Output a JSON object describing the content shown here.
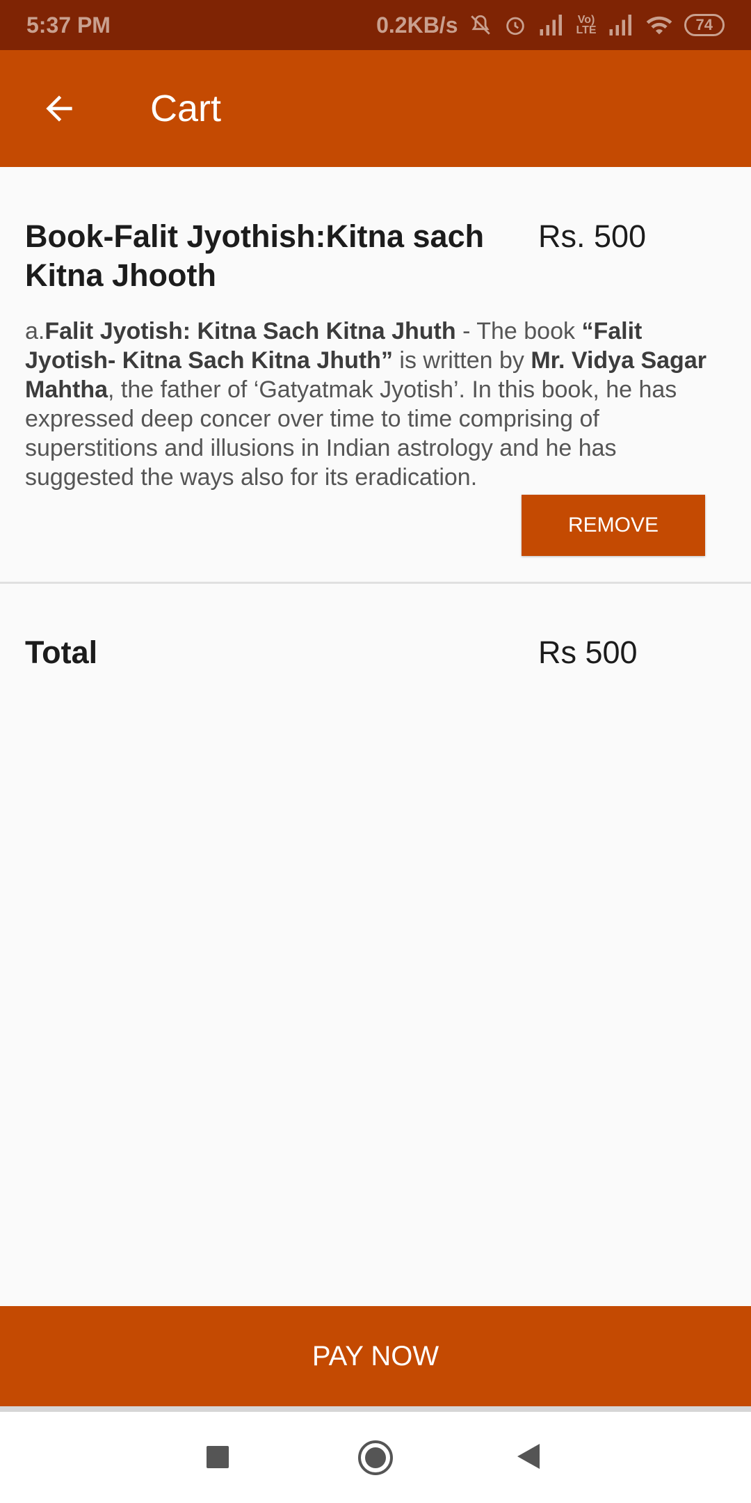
{
  "status_bar": {
    "time": "5:37 PM",
    "speed": "0.2KB/s",
    "battery": "74",
    "icons": [
      "mute-icon",
      "alarm-icon",
      "signal-icon",
      "volte-icon",
      "signal-icon",
      "wifi-icon",
      "battery-icon"
    ]
  },
  "app_bar": {
    "back_icon": "arrow-left-icon",
    "title": "Cart"
  },
  "cart_item": {
    "title": "Book-Falit Jyothish:Kitna sach Kitna Jhooth",
    "price": "Rs. 500",
    "description": {
      "prefix": "a.",
      "book_name": "Falit Jyotish: Kitna Sach Kitna Jhuth",
      "text1": " - The book ",
      "book_quote": "“Falit Jyotish- Kitna Sach Kitna Jhuth”",
      "text2": " is written by ",
      "author": "Mr. Vidya Sagar Mahtha",
      "text3": ", the father of ‘Gatyatmak Jyotish’. In this book, he has expressed deep concer over time to time comprising of superstitions and illusions in Indian astrology and he has suggested the ways also for its eradication."
    },
    "remove_label": "REMOVE"
  },
  "total": {
    "label": "Total",
    "value": "Rs 500"
  },
  "pay_label": "PAY NOW",
  "nav": {
    "icons": [
      "recents-icon",
      "home-icon",
      "back-icon"
    ]
  },
  "colors": {
    "status_bar": "#7f2404",
    "accent": "#c44a02"
  }
}
